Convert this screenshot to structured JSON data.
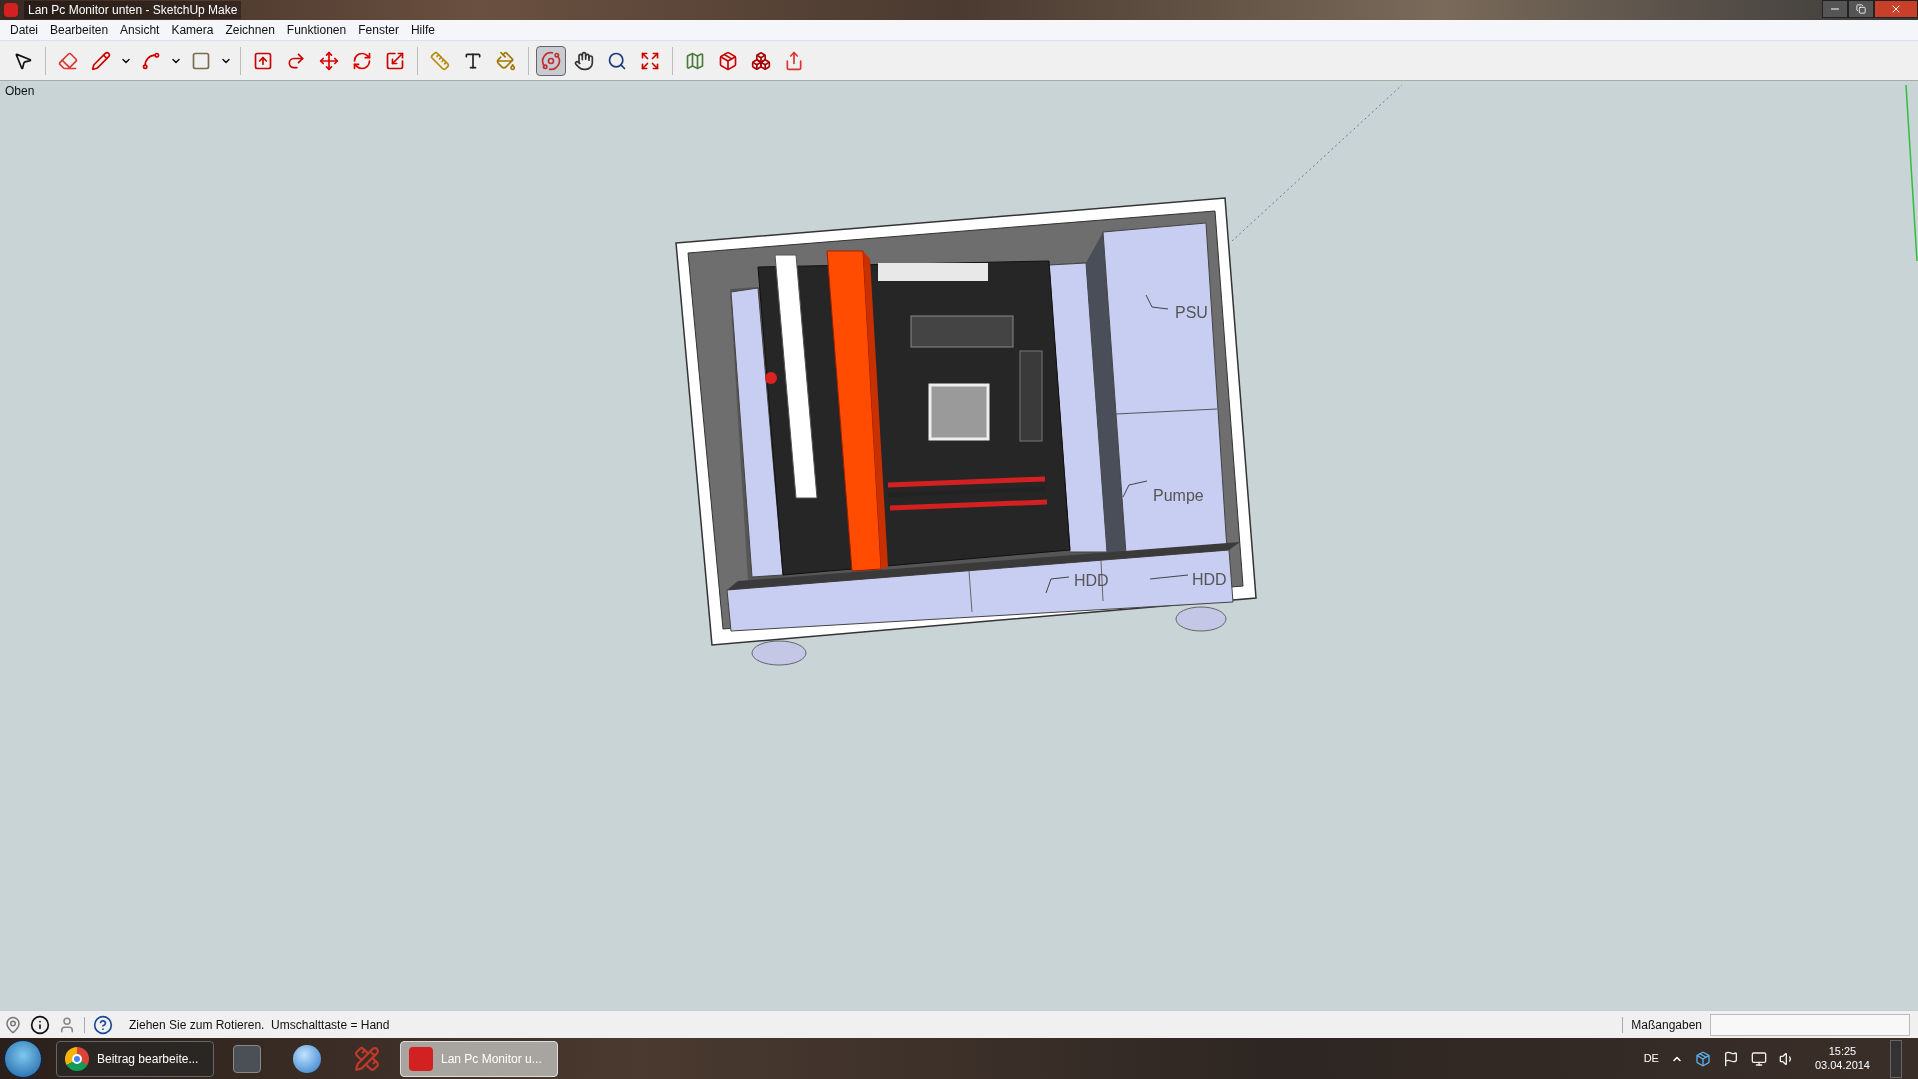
{
  "window": {
    "title": "Lan Pc Monitor unten - SketchUp Make"
  },
  "menu": [
    "Datei",
    "Bearbeiten",
    "Ansicht",
    "Kamera",
    "Zeichnen",
    "Funktionen",
    "Fenster",
    "Hilfe"
  ],
  "toolbar": [
    [
      {
        "kind": "select",
        "selected": false
      }
    ],
    [
      {
        "kind": "eraser",
        "selected": false
      },
      {
        "kind": "pencil",
        "selected": false
      },
      {
        "kind": "caret",
        "selected": false
      },
      {
        "kind": "arc",
        "selected": false
      },
      {
        "kind": "caret",
        "selected": false
      },
      {
        "kind": "rectangle",
        "selected": false
      },
      {
        "kind": "caret",
        "selected": false
      }
    ],
    [
      {
        "kind": "pushpull",
        "selected": false
      },
      {
        "kind": "followme",
        "selected": false
      },
      {
        "kind": "move",
        "selected": false
      },
      {
        "kind": "rotate",
        "selected": false
      },
      {
        "kind": "scale",
        "selected": false
      }
    ],
    [
      {
        "kind": "tape",
        "selected": false
      },
      {
        "kind": "text",
        "selected": false
      },
      {
        "kind": "paint",
        "selected": false
      }
    ],
    [
      {
        "kind": "orbit",
        "selected": true
      },
      {
        "kind": "pan",
        "selected": false
      },
      {
        "kind": "zoom",
        "selected": false
      },
      {
        "kind": "zoomextents",
        "selected": false
      }
    ],
    [
      {
        "kind": "map",
        "selected": false
      },
      {
        "kind": "warehouse",
        "selected": false
      },
      {
        "kind": "components",
        "selected": false
      },
      {
        "kind": "share",
        "selected": false
      }
    ]
  ],
  "viewport": {
    "view_name": "Oben",
    "labels": [
      {
        "kind": "psu",
        "text": "PSU"
      },
      {
        "kind": "pump",
        "text": "Pumpe"
      },
      {
        "kind": "hdd_left",
        "text": "HDD"
      },
      {
        "kind": "hdd_right",
        "text": "HDD"
      }
    ]
  },
  "status_bar": {
    "message": "Ziehen Sie zum Rotieren.  Umschalttaste = Hand",
    "measurements_label": "Maßangaben"
  },
  "taskbar": {
    "items": [
      {
        "kind": "browser",
        "label": "Beitrag bearbeite...",
        "selected": false
      },
      {
        "kind": "game",
        "selected": false
      },
      {
        "kind": "office",
        "selected": false
      },
      {
        "kind": "sketch",
        "selected": false
      },
      {
        "kind": "sketchup",
        "label": "Lan Pc Monitor u...",
        "selected": true
      }
    ],
    "language": "DE",
    "time": "15:25",
    "date": "03.04.2014"
  }
}
